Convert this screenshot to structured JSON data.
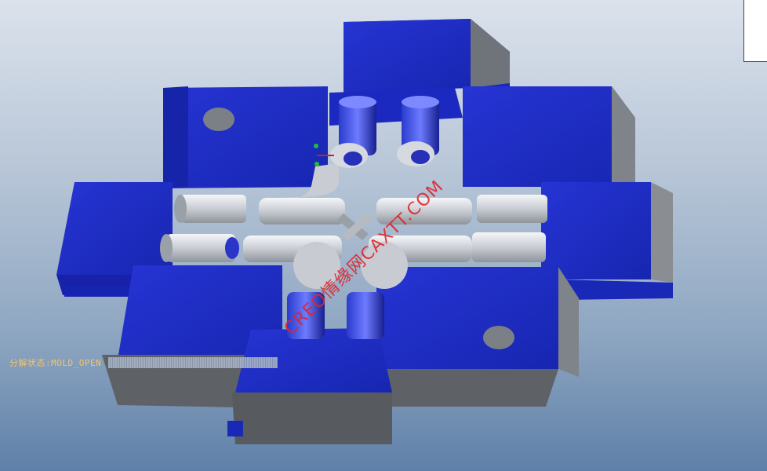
{
  "viewer": {
    "status": {
      "key_label": "分解状态",
      "separator": ":",
      "value": "MOLD_OPEN"
    },
    "watermark": "CREO情缘网CAXTT.COM"
  },
  "colors": {
    "mold_blue": "#1f2fbf",
    "mold_dark_blue": "#121a8a",
    "mold_gray": "#8a8d92",
    "mold_gray_dark": "#5b5e63",
    "pipe_light": "#d9dde2",
    "background_top": "#dbe2ec",
    "background_bottom": "#5f80a8",
    "watermark_red": "#e0252a",
    "status_label": "#f2c56b"
  }
}
